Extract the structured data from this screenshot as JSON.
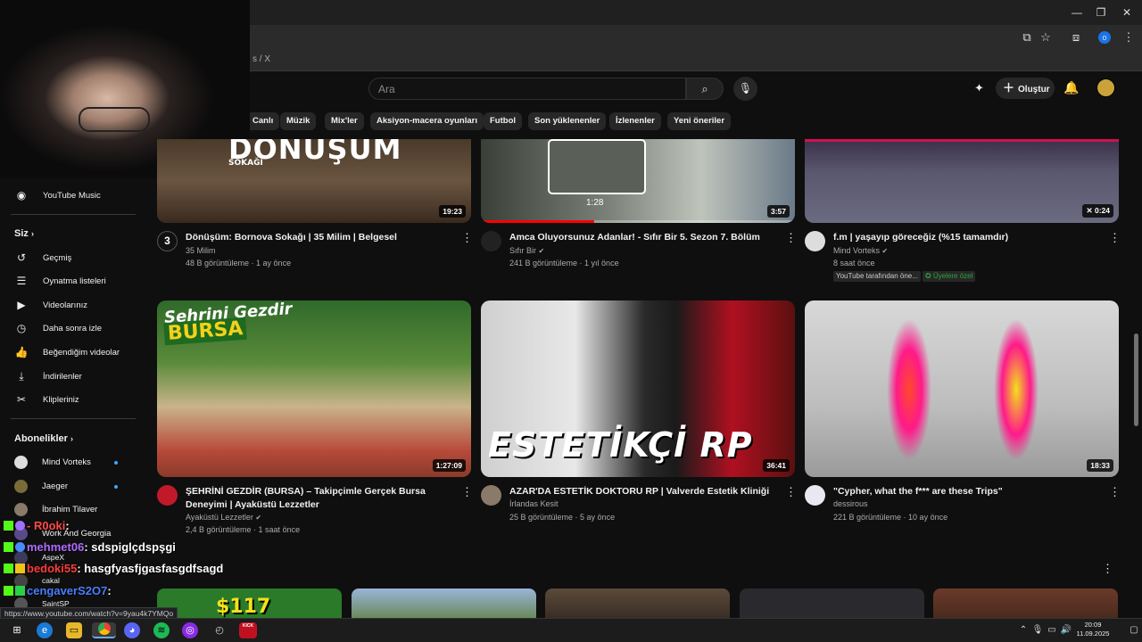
{
  "browser": {
    "bookmark_text": "s / X",
    "profile_badge": "o"
  },
  "header": {
    "search_placeholder": "Ara",
    "create_label": "Oluştur"
  },
  "chips": [
    "Canlı",
    "Müzik",
    "Mix'ler",
    "Aksiyon-macera oyunları",
    "Futbol",
    "Son yüklenenler",
    "İzlenenler",
    "Yeni öneriler"
  ],
  "sidebar": {
    "youtube_music": "YouTube Music",
    "you_heading": "Siz",
    "you_items": [
      "Geçmiş",
      "Oynatma listeleri",
      "Videolarınız",
      "Daha sonra izle",
      "Beğendiğim videolar",
      "İndirilenler",
      "Klipleriniz"
    ],
    "subs_heading": "Abonelikler",
    "subs": [
      "Mind Vorteks",
      "Jaeger",
      "İbrahim Tilaver",
      "Work And Georgia",
      "AspeX",
      "cakal",
      "SaintSP"
    ]
  },
  "videos": [
    {
      "title": "Dönüşüm: Bornova Sokağı | 35 Milim | Belgesel",
      "channel": "35 Milim",
      "meta": "48 B görüntüleme · 1 ay önce",
      "duration": "19:23",
      "thumb_text": "DÖNÜŞÜM",
      "thumb_sub": "SOKAĞI"
    },
    {
      "title": "Amca Oluyorsunuz Adanlar! - Sıfır Bir 5. Sezon 7. Bölüm",
      "channel": "Sıfır Bir",
      "meta": "241 B görüntüleme · 1 yıl önce",
      "duration": "3:57",
      "preview_time": "1:28"
    },
    {
      "title": "f.m | yaşayıp göreceğiz (%15 tamamdır)",
      "channel": "Mind Vorteks",
      "meta": "8 saat önce",
      "duration": "0:24",
      "badge1": "YouTube tarafından öne...",
      "badge2": "Üyelere özel"
    },
    {
      "title": "ŞEHRİNİ GEZDİR (BURSA) – Takipçimle Gerçek Bursa Deneyimi | Ayaküstü Lezzetler",
      "channel": "Ayaküstü Lezzetler",
      "meta": "2,4 B görüntüleme · 1 saat önce",
      "duration": "1:27:09",
      "thumb_text": "Şehrini Gezdir",
      "thumb_sub": "BURSA"
    },
    {
      "title": "AZAR'DA ESTETİK DOKTORU RP | Valverde Estetik Kliniği",
      "channel": "İrlandas Kesit",
      "meta": "25 B görüntüleme · 5 ay önce",
      "duration": "36:41",
      "thumb_text": "ESTETİKÇİ RP"
    },
    {
      "title": "\"Cypher, what the f*** are these Trips\"",
      "channel": "dessirous",
      "meta": "221 B görüntüleme · 10 ay önce",
      "duration": "18:33"
    }
  ],
  "next_row": {
    "thumb_text": "$117"
  },
  "chat": [
    {
      "name": "R0oki",
      "msg": ":",
      "name_color": "#ff4a4a"
    },
    {
      "name": "mehmet06",
      "msg": ": sdspiglçdspşgi",
      "name_color": "#b06cff"
    },
    {
      "name": "bedoki55",
      "msg": ": hasgfyasfjgasfasgdfsagd",
      "name_color": "#ff3b3b"
    },
    {
      "name": "cengaverS2O7",
      "msg": ":",
      "name_color": "#4a7dff"
    }
  ],
  "status_url": "https://www.youtube.com/watch?v=9yau4k7YMQo",
  "taskbar": {
    "time": "20:09",
    "date": "11.09.2025",
    "kick_label": "KICK"
  },
  "colors": {
    "accent_red": "#ff0000",
    "link_blue": "#3ea6ff",
    "member_green": "#2ba640"
  }
}
